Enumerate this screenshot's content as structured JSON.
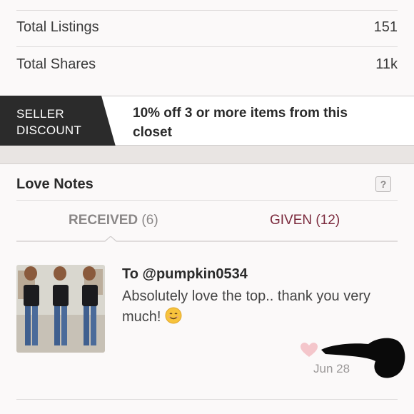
{
  "stats": {
    "rows": [
      {
        "label": "Total Listings",
        "value": "151"
      },
      {
        "label": "Total Shares",
        "value": "11k"
      }
    ]
  },
  "discount": {
    "tag_line1": "SELLER",
    "tag_line2": "DISCOUNT",
    "text": "10% off 3 or more items from this closet"
  },
  "love_notes": {
    "title": "Love Notes",
    "help": "?",
    "tabs": {
      "received_label": "RECEIVED",
      "received_count": "(6)",
      "given_label": "GIVEN (12)"
    },
    "note": {
      "to": "To @pumpkin0534",
      "message": "Absolutely love the top.. thank you very much!",
      "date": "Jun 28"
    }
  },
  "colors": {
    "tag_bg": "#2b2b2b",
    "accent_given": "#7b2a3d",
    "heart": "#f4c6cb"
  }
}
